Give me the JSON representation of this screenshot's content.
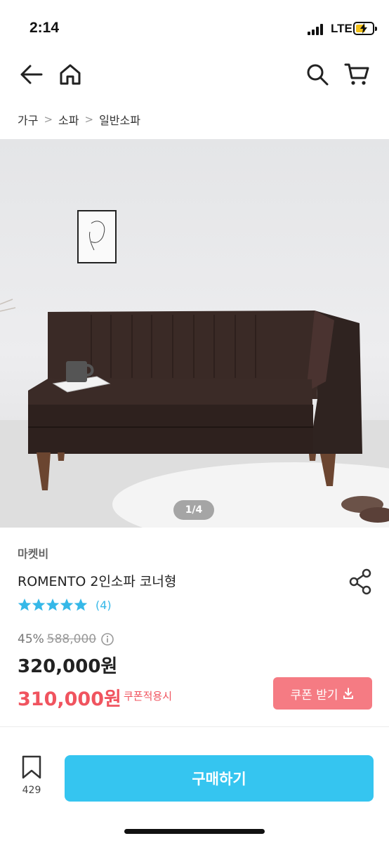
{
  "status_bar": {
    "time": "2:14",
    "network": "LTE"
  },
  "nav": {
    "back_icon": "arrow-left-icon",
    "home_icon": "home-icon",
    "search_icon": "search-icon",
    "cart_icon": "cart-icon"
  },
  "breadcrumb": [
    "가구",
    "소파",
    "일반소파"
  ],
  "gallery": {
    "counter": "1/4"
  },
  "product": {
    "brand": "마켓비",
    "name": "ROMENTO 2인소파 코너형",
    "rating_stars": 5,
    "review_count": "(4)",
    "discount": "45%",
    "original_price": "588,000",
    "sale_price": "320,000원",
    "coupon_price": "310,000원",
    "coupon_note": "쿠폰적용시",
    "coupon_button": "쿠폰 받기"
  },
  "bottom": {
    "bookmark_count": "429",
    "buy_label": "구매하기"
  },
  "colors": {
    "accent": "#35c5f0",
    "coupon": "#f0545f",
    "coupon_button": "#f57b83",
    "star": "#35b8e8"
  }
}
